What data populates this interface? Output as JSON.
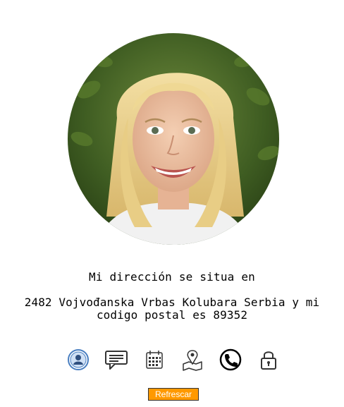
{
  "profile": {
    "photo_alt": "user photo",
    "label": "Mi dirección se situa en",
    "value": "2482 Vojvođanska Vrbas Kolubara Serbia y mi codigo postal es 89352"
  },
  "icons": [
    {
      "name": "user-icon",
      "active": true
    },
    {
      "name": "chat-icon",
      "active": false
    },
    {
      "name": "calendar-icon",
      "active": false
    },
    {
      "name": "map-icon",
      "active": false
    },
    {
      "name": "phone-icon",
      "active": false
    },
    {
      "name": "lock-icon",
      "active": false
    }
  ],
  "refresh_button": {
    "label": "Refrescar"
  },
  "colors": {
    "button_bg": "#ff9900",
    "button_text": "#ffffff",
    "active_icon": "#4a7fc1",
    "icon_stroke": "#333333"
  }
}
